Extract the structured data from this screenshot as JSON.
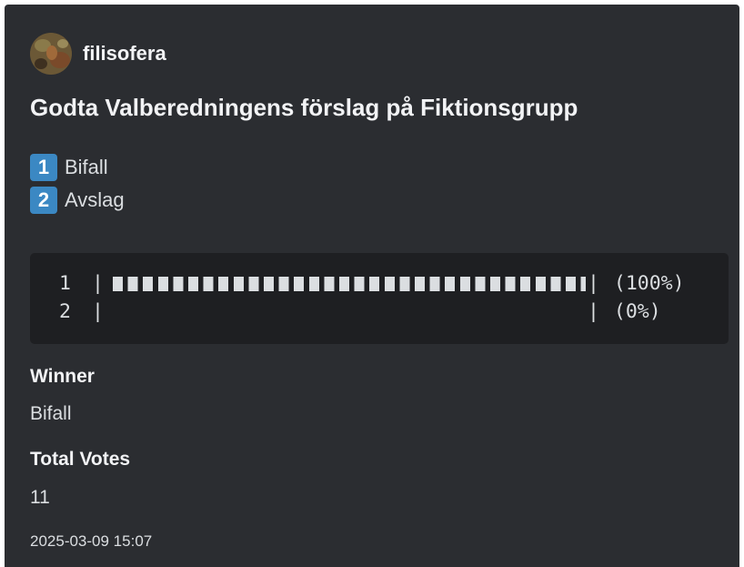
{
  "author": {
    "name": "filisofera",
    "avatar_icon": "user-avatar-photo"
  },
  "poll": {
    "title": "Godta Valberedningens förslag på Fiktionsgrupp",
    "options": [
      {
        "number": "1",
        "label": "Bifall"
      },
      {
        "number": "2",
        "label": "Avslag"
      }
    ]
  },
  "results": [
    {
      "number": "1",
      "fraction": 1.0,
      "percent_label": "(100%)"
    },
    {
      "number": "2",
      "fraction": 0.0,
      "percent_label": "(0%)"
    }
  ],
  "fields": {
    "winner_label": "Winner",
    "winner_value": "Bifall",
    "total_votes_label": "Total Votes",
    "total_votes_value": "11"
  },
  "timestamp": "2025-03-09 15:07",
  "colors": {
    "embed_background": "#2b2d31",
    "codeblock_background": "#1e1f22",
    "keycap_blue": "#3b88c3",
    "text": "#dbdee1"
  }
}
